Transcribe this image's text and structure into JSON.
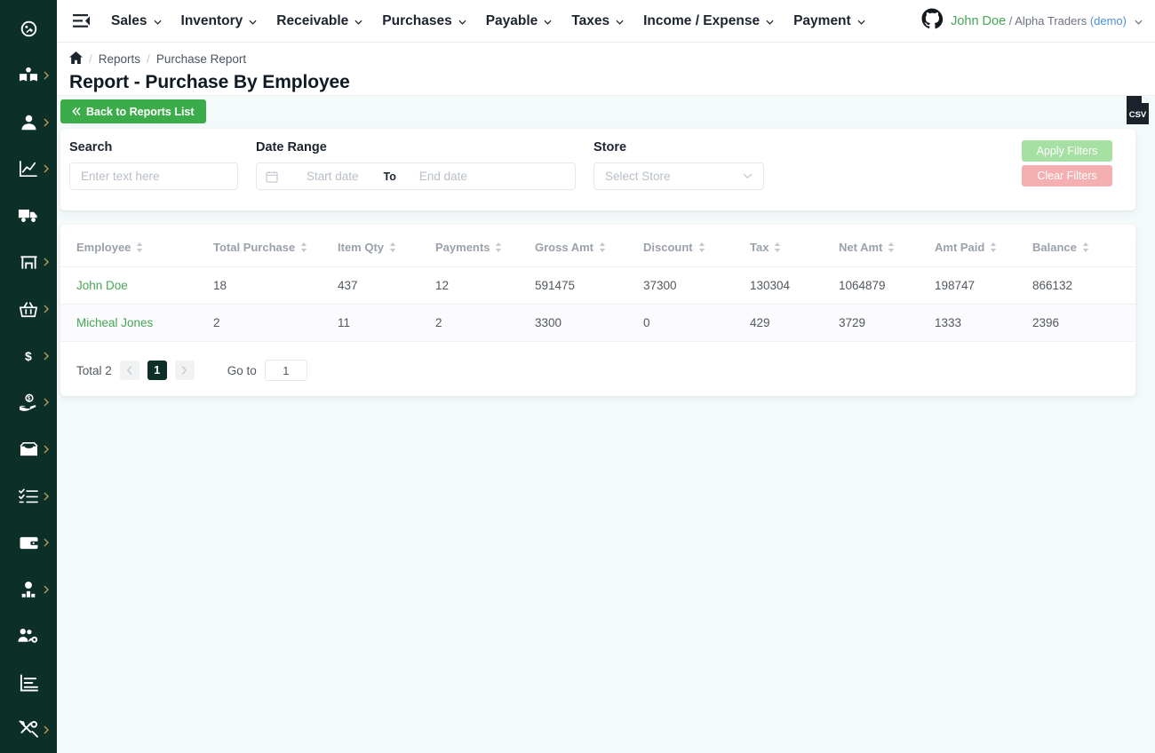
{
  "sidebar": {
    "items": [
      {
        "name": "dashboard",
        "icon": "dashboard-gauge-icon",
        "caret": false
      },
      {
        "name": "catalog",
        "icon": "open-book-person-icon",
        "caret": true
      },
      {
        "name": "customers",
        "icon": "user-icon",
        "caret": true
      },
      {
        "name": "sales",
        "icon": "line-chart-icon",
        "caret": true
      },
      {
        "name": "shipping",
        "icon": "delivery-truck-icon",
        "caret": false
      },
      {
        "name": "store",
        "icon": "storefront-icon",
        "caret": true
      },
      {
        "name": "purchases",
        "icon": "shopping-basket-icon",
        "caret": true
      },
      {
        "name": "receivable",
        "icon": "dollar-arrow-icon",
        "caret": true
      },
      {
        "name": "payable",
        "icon": "hand-money-icon",
        "caret": true
      },
      {
        "name": "taxes",
        "icon": "money-box-icon",
        "caret": true
      },
      {
        "name": "tasks",
        "icon": "checklist-icon",
        "caret": true
      },
      {
        "name": "payment",
        "icon": "wallet-icon",
        "caret": true
      },
      {
        "name": "employees",
        "icon": "employee-badge-icon",
        "caret": true
      },
      {
        "name": "users",
        "icon": "users-gear-icon",
        "caret": false
      },
      {
        "name": "reports",
        "icon": "bar-report-icon",
        "caret": false
      },
      {
        "name": "settings",
        "icon": "tools-icon",
        "caret": true
      }
    ]
  },
  "topbar": {
    "menu_toggle": "collapse-menu-icon",
    "nav": [
      {
        "label": "Sales"
      },
      {
        "label": "Inventory"
      },
      {
        "label": "Receivable"
      },
      {
        "label": "Purchases"
      },
      {
        "label": "Payable"
      },
      {
        "label": "Taxes"
      },
      {
        "label": "Income / Expense"
      },
      {
        "label": "Payment"
      }
    ],
    "user": {
      "avatar_icon": "github-avatar-icon",
      "name": "John Doe",
      "separator": " / ",
      "company": "Alpha Traders ",
      "tenant": "(demo)"
    }
  },
  "header": {
    "breadcrumb": {
      "home_icon": "home-icon",
      "items": [
        "Reports",
        "Purchase Report"
      ],
      "separator": "/"
    },
    "title": "Report - Purchase By Employee"
  },
  "toolbar": {
    "back_label": "Back to Reports List",
    "back_icon": "double-chevron-left-icon",
    "export_icon": "csv-file-icon",
    "export_label": "CSV"
  },
  "filters": {
    "search": {
      "label": "Search",
      "placeholder": "Enter text here",
      "value": ""
    },
    "date_range": {
      "label": "Date Range",
      "calendar_icon": "calendar-icon",
      "start_placeholder": "Start date",
      "to_label": "To",
      "end_placeholder": "End date",
      "start_value": "",
      "end_value": ""
    },
    "store": {
      "label": "Store",
      "placeholder": "Select Store",
      "selected": "",
      "chevron_icon": "chevron-down-icon"
    },
    "apply_label": "Apply Filters",
    "clear_label": "Clear Filters"
  },
  "table": {
    "sort_icon": "sort-updown-icon",
    "columns": [
      "Employee",
      "Total Purchase",
      "Item Qty",
      "Payments",
      "Gross Amt",
      "Discount",
      "Tax",
      "Net Amt",
      "Amt Paid",
      "Balance"
    ],
    "rows": [
      {
        "employee": "John Doe",
        "total_purchase": "18",
        "item_qty": "437",
        "payments": "12",
        "gross_amt": "591475",
        "discount": "37300",
        "tax": "130304",
        "net_amt": "1064879",
        "amt_paid": "198747",
        "balance": "866132"
      },
      {
        "employee": "Micheal Jones",
        "total_purchase": "2",
        "item_qty": "11",
        "payments": "2",
        "gross_amt": "3300",
        "discount": "0",
        "tax": "429",
        "net_amt": "3729",
        "amt_paid": "1333",
        "balance": "2396"
      }
    ]
  },
  "pagination": {
    "total_label": "Total 2",
    "prev_icon": "chevron-left-icon",
    "next_icon": "chevron-right-icon",
    "current_page": "1",
    "goto_label": "Go to",
    "goto_value": "1"
  },
  "colors": {
    "sidebar_bg": "#0c3028",
    "accent_green": "#3cab4a",
    "link_green": "#46a556",
    "apply_green": "#a6e0a3",
    "clear_red": "#f4b0b0",
    "page_bg": "#f4f9fa"
  }
}
